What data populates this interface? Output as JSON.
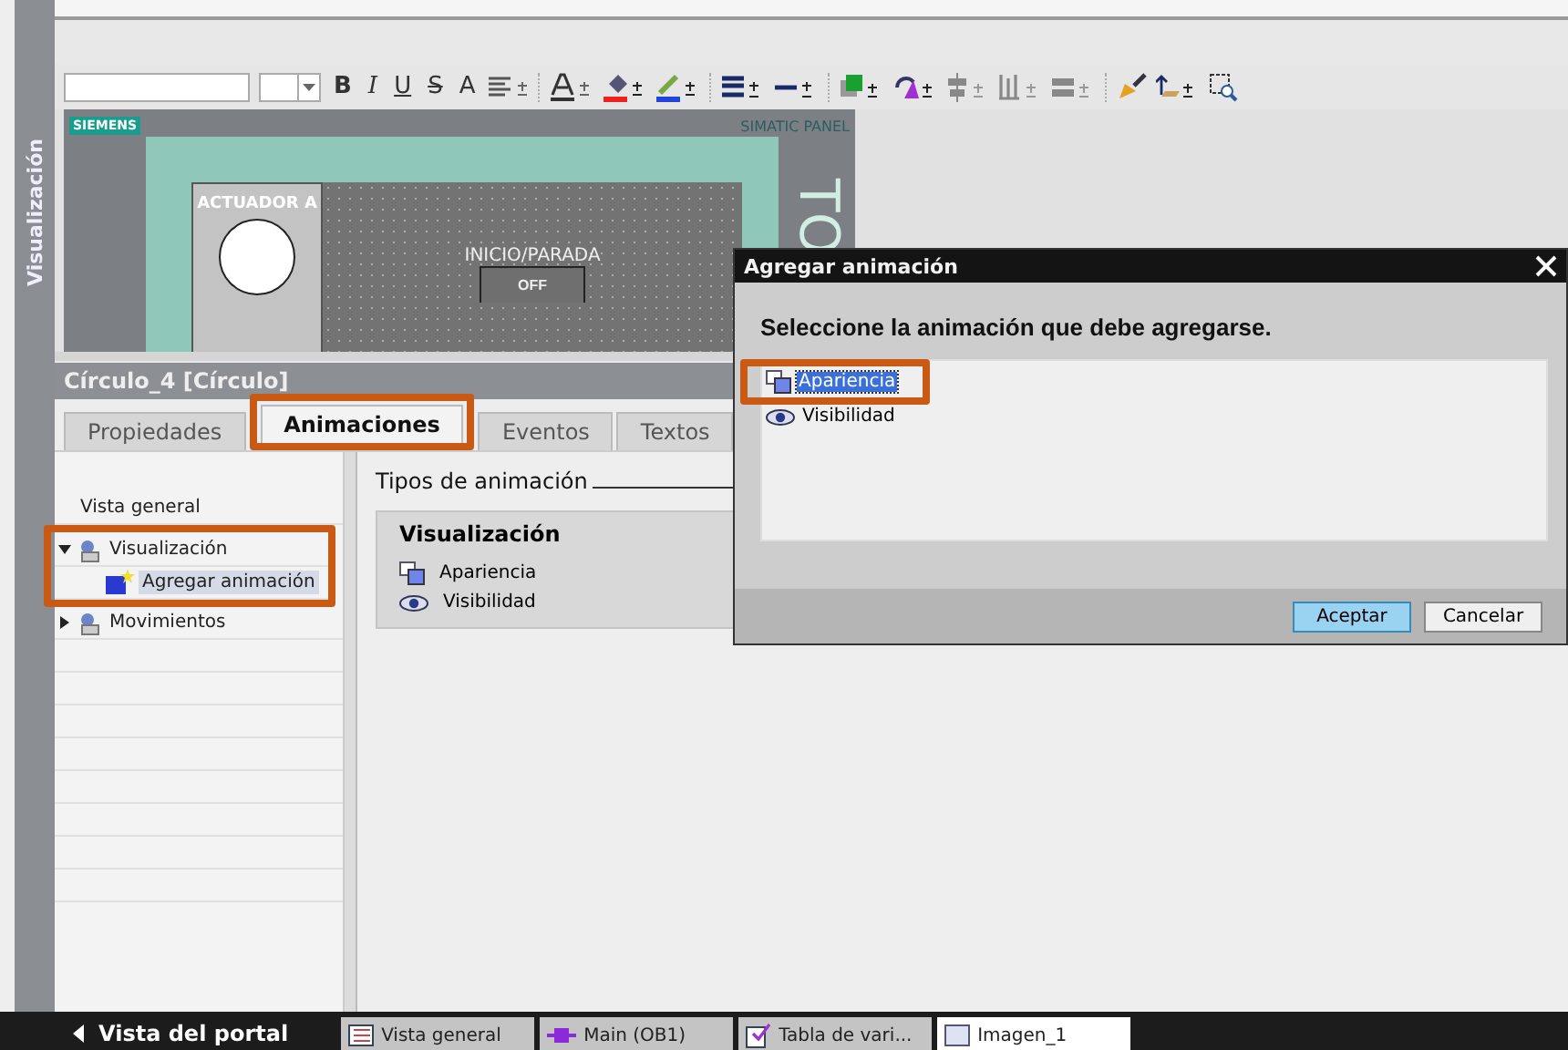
{
  "side_tab": {
    "label": "Visualización"
  },
  "toolbar": {
    "format_buttons": [
      {
        "label": "B",
        "kind": "bold"
      },
      {
        "label": "I",
        "kind": "italic"
      },
      {
        "label": "U",
        "kind": "underline"
      },
      {
        "label": "S",
        "kind": "strike"
      },
      {
        "label": "A",
        "kind": "plain"
      }
    ]
  },
  "hmi_panel": {
    "brand": "SIEMENS",
    "model": "SIMATIC PANEL",
    "side_text": "TO",
    "actuator_label": "ACTUADOR A",
    "start_stop_label": "INICIO/PARADA",
    "button_label": "OFF"
  },
  "properties": {
    "title": "Círculo_4 [Círculo]",
    "tabs": [
      {
        "label": "Propiedades",
        "selected": false
      },
      {
        "label": "Animaciones",
        "selected": true
      },
      {
        "label": "Eventos",
        "selected": false
      },
      {
        "label": "Textos",
        "selected": false
      }
    ],
    "tree": [
      {
        "label": "Vista general",
        "selected": false
      },
      {
        "label": "Visualización",
        "selected": false,
        "expanded": true,
        "children": [
          {
            "label": "Agregar animación",
            "selected": true
          }
        ]
      },
      {
        "label": "Movimientos",
        "selected": false,
        "expanded": false
      }
    ],
    "section_heading": "Tipos de animación",
    "group": {
      "title": "Visualización",
      "items": [
        {
          "label": "Apariencia",
          "kind": "appearance"
        },
        {
          "label": "Visibilidad",
          "kind": "visibility"
        }
      ]
    }
  },
  "dialog": {
    "title": "Agregar animación",
    "prompt": "Seleccione la animación que debe agregarse.",
    "items": [
      {
        "label": "Apariencia",
        "kind": "appearance",
        "selected": true
      },
      {
        "label": "Visibilidad",
        "kind": "visibility",
        "selected": false
      }
    ],
    "buttons": [
      {
        "label": "Aceptar",
        "kind": "primary"
      },
      {
        "label": "Cancelar",
        "kind": "secondary"
      }
    ]
  },
  "taskbar": {
    "portal": "Vista del portal",
    "tabs": [
      {
        "label": "Vista general",
        "kind": "overview",
        "selected": false
      },
      {
        "label": "Main (OB1)",
        "kind": "block",
        "selected": false
      },
      {
        "label": "Tabla de vari...",
        "kind": "table",
        "selected": false
      },
      {
        "label": "Imagen_1",
        "kind": "screen",
        "selected": true
      }
    ]
  }
}
